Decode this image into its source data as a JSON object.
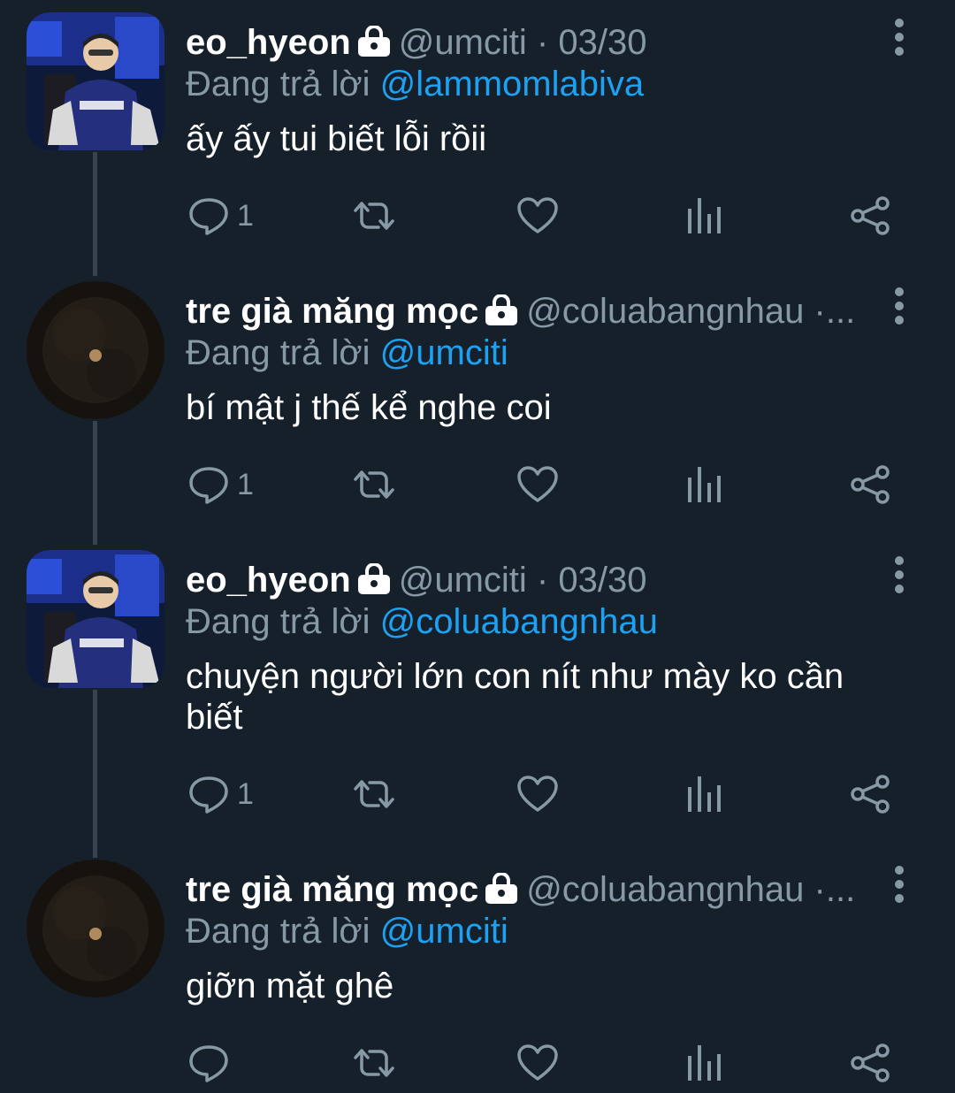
{
  "thread": {
    "tweets": [
      {
        "name": "eo_hyeon",
        "handle": "@umciti",
        "separator": "·",
        "date": "03/30",
        "reply_label": "Đang trả lời",
        "reply_to": "@lammomlabiva",
        "text": "ấy ấy tui biết lỗi rồii",
        "reply_count": "1",
        "avatar": "player-photo-avatar",
        "locked": true
      },
      {
        "name": "tre già măng mọc",
        "handle": "@coluabangnhau",
        "separator": "·...",
        "date": "",
        "reply_label": "Đang trả lời",
        "reply_to": "@umciti",
        "text": "bí mật j thế kể nghe coi",
        "reply_count": "1",
        "avatar": "moon-night-avatar",
        "locked": true
      },
      {
        "name": "eo_hyeon",
        "handle": "@umciti",
        "separator": "·",
        "date": "03/30",
        "reply_label": "Đang trả lời",
        "reply_to": "@coluabangnhau",
        "text": "chuyện người lớn con nít như mày ko cần biết",
        "reply_count": "1",
        "avatar": "player-photo-avatar",
        "locked": true
      },
      {
        "name": "tre già măng mọc",
        "handle": "@coluabangnhau",
        "separator": "·...",
        "date": "",
        "reply_label": "Đang trả lời",
        "reply_to": "@umciti",
        "text": "giỡn mặt ghê",
        "reply_count": "",
        "avatar": "moon-night-avatar",
        "locked": true
      }
    ]
  },
  "icons": {
    "reply": "comment-icon",
    "retweet": "retweet-icon",
    "like": "heart-icon",
    "analytics": "analytics-icon",
    "share": "share-icon",
    "more": "more-vertical-icon",
    "lock": "lock-icon"
  },
  "colors": {
    "background": "#15202b",
    "text": "#ffffff",
    "muted": "#8899a6",
    "link": "#1da1f2",
    "thread_line": "#38444d"
  }
}
